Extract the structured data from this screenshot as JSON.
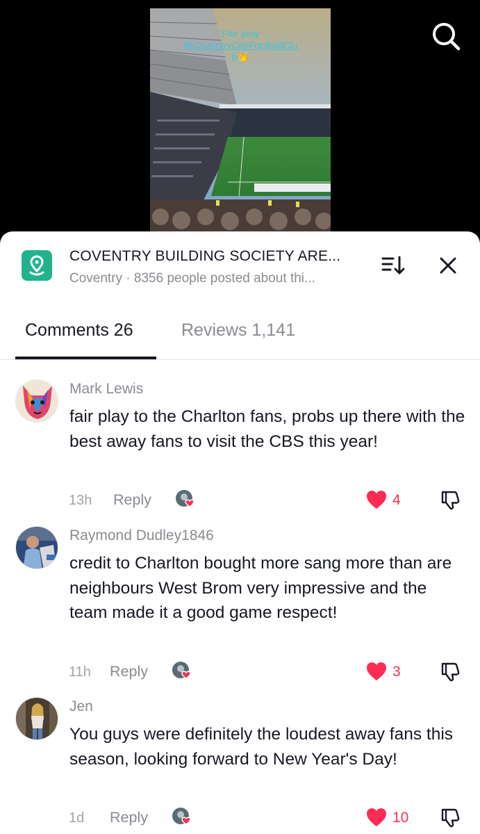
{
  "video": {
    "caption_line1": "Fair play",
    "caption_line2": "@CoventryCityFootballClu",
    "caption_line3": "b👏"
  },
  "header": {
    "icon": "location-pin-icon",
    "title": "COVENTRY BUILDING SOCIETY ARE...",
    "subtitle": "Coventry · 8356 people posted about thi..."
  },
  "tabs": [
    {
      "label": "Comments 26",
      "active": true
    },
    {
      "label": "Reviews 1,141",
      "active": false
    }
  ],
  "comments": [
    {
      "name": "Mark Lewis",
      "text": "fair play to the Charlton fans, probs up there with the best away fans to visit the CBS this year!",
      "time": "13h",
      "reply": "Reply",
      "likes": "4"
    },
    {
      "name": "Raymond Dudley1846",
      "text": "credit to Charlton bought more sang more than are neighbours West Brom very impressive and the team made it a good game respect!",
      "time": "11h",
      "reply": "Reply",
      "likes": "3"
    },
    {
      "name": "Jen",
      "text": "You guys were definitely the loudest away fans this season, looking forward to New Year's Day!",
      "time": "1d",
      "reply": "Reply",
      "likes": "10"
    }
  ],
  "colors": {
    "accent": "#fe2c55",
    "place_icon": "#22b38c",
    "caption": "#3fc4dc"
  }
}
